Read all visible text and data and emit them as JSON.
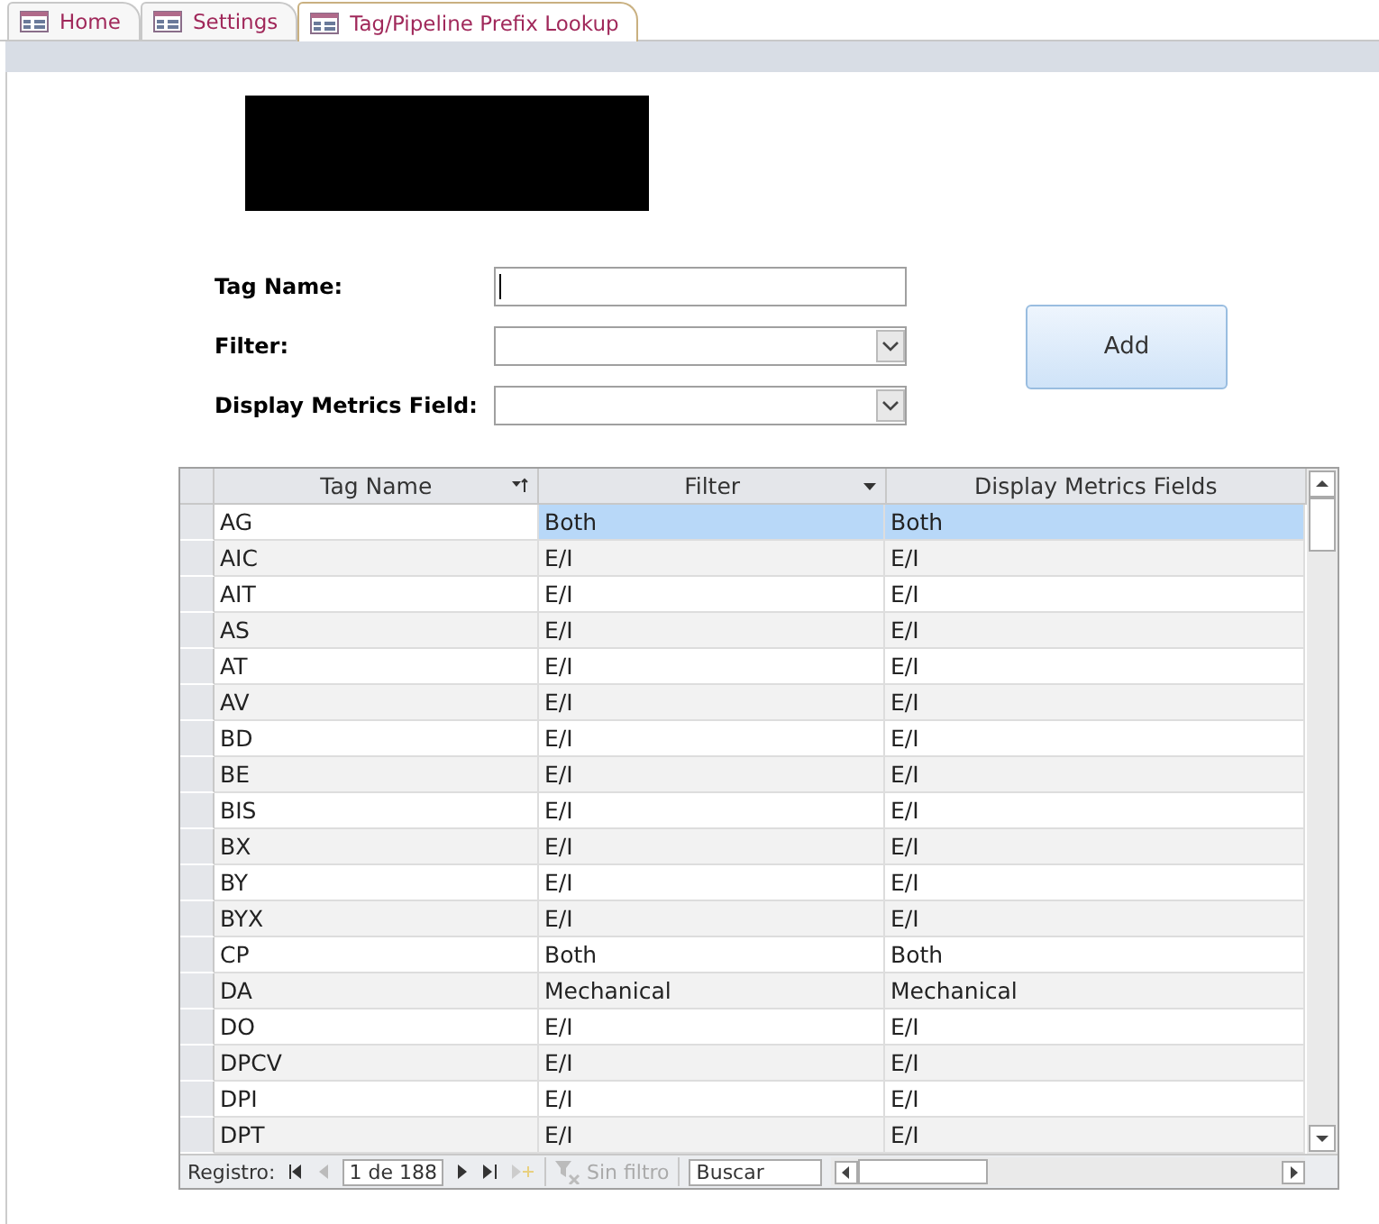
{
  "tabs": [
    {
      "label": "Home",
      "selected": false
    },
    {
      "label": "Settings",
      "selected": false
    },
    {
      "label": "Tag/Pipeline Prefix Lookup",
      "selected": true
    }
  ],
  "form": {
    "fields": [
      {
        "label": "Tag Name:",
        "kind": "text"
      },
      {
        "label": "Filter:",
        "kind": "combo"
      },
      {
        "label": "Display Metrics Field:",
        "kind": "combo"
      }
    ],
    "button": "Add"
  },
  "table": {
    "columns": [
      {
        "label": "Tag Name",
        "kind": "sorted"
      },
      {
        "label": "Filter",
        "kind": "filter"
      },
      {
        "label": "Display Metrics Fields",
        "kind": "plain"
      }
    ],
    "rows": [
      {
        "cells": [
          "AG",
          "Both",
          "Both"
        ],
        "selected": true
      },
      {
        "cells": [
          "AIC",
          "E/I",
          "E/I"
        ],
        "selected": false
      },
      {
        "cells": [
          "AIT",
          "E/I",
          "E/I"
        ],
        "selected": false
      },
      {
        "cells": [
          "AS",
          "E/I",
          "E/I"
        ],
        "selected": false
      },
      {
        "cells": [
          "AT",
          "E/I",
          "E/I"
        ],
        "selected": false
      },
      {
        "cells": [
          "AV",
          "E/I",
          "E/I"
        ],
        "selected": false
      },
      {
        "cells": [
          "BD",
          "E/I",
          "E/I"
        ],
        "selected": false
      },
      {
        "cells": [
          "BE",
          "E/I",
          "E/I"
        ],
        "selected": false
      },
      {
        "cells": [
          "BIS",
          "E/I",
          "E/I"
        ],
        "selected": false
      },
      {
        "cells": [
          "BX",
          "E/I",
          "E/I"
        ],
        "selected": false
      },
      {
        "cells": [
          "BY",
          "E/I",
          "E/I"
        ],
        "selected": false
      },
      {
        "cells": [
          "BYX",
          "E/I",
          "E/I"
        ],
        "selected": false
      },
      {
        "cells": [
          "CP",
          "Both",
          "Both"
        ],
        "selected": false
      },
      {
        "cells": [
          "DA",
          "Mechanical",
          "Mechanical"
        ],
        "selected": false
      },
      {
        "cells": [
          "DO",
          "E/I",
          "E/I"
        ],
        "selected": false
      },
      {
        "cells": [
          "DPCV",
          "E/I",
          "E/I"
        ],
        "selected": false
      },
      {
        "cells": [
          "DPI",
          "E/I",
          "E/I"
        ],
        "selected": false
      },
      {
        "cells": [
          "DPT",
          "E/I",
          "E/I"
        ],
        "selected": false
      }
    ],
    "navigation": {
      "label": "Registro:",
      "position": "1 de 188",
      "filter": "Sin filtro",
      "search": "Buscar"
    }
  }
}
